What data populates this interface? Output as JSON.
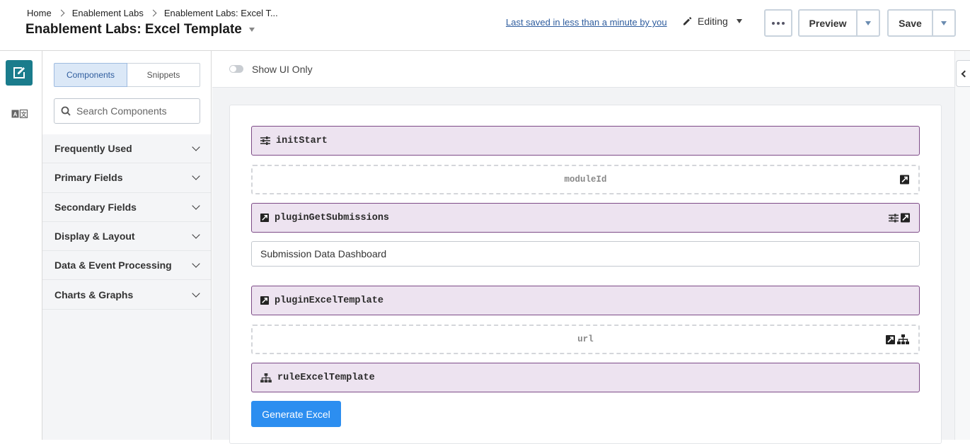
{
  "header": {
    "breadcrumbs": [
      "Home",
      "Enablement Labs",
      "Enablement Labs: Excel T..."
    ],
    "title": "Enablement Labs: Excel Template",
    "last_saved": "Last saved in less than a minute by you",
    "mode_label": "Editing",
    "preview_label": "Preview",
    "save_label": "Save"
  },
  "panel": {
    "tabs": [
      "Components",
      "Snippets"
    ],
    "active_tab": "Components",
    "search_placeholder": "Search Components",
    "categories": [
      "Frequently Used",
      "Primary Fields",
      "Secondary Fields",
      "Display & Layout",
      "Data & Event Processing",
      "Charts & Graphs"
    ]
  },
  "toolbar": {
    "show_ui_only_label": "Show UI Only",
    "show_ui_only_on": false
  },
  "canvas": {
    "blocks": [
      {
        "label": "initStart",
        "kind": "init"
      },
      {
        "label": "moduleId",
        "kind": "hidden"
      },
      {
        "label": "pluginGetSubmissions",
        "kind": "plugin"
      },
      {
        "label": "pluginExcelTemplate",
        "kind": "plugin"
      },
      {
        "label": "url",
        "kind": "hidden"
      },
      {
        "label": "ruleExcelTemplate",
        "kind": "rule"
      }
    ],
    "text_field_value": "Submission Data Dashboard",
    "button_label": "Generate Excel"
  },
  "colors": {
    "accent": "#2c8ef0",
    "rail_active": "#1a7c8c",
    "block_bg": "#ede3f0",
    "block_border": "#7d4b87"
  }
}
